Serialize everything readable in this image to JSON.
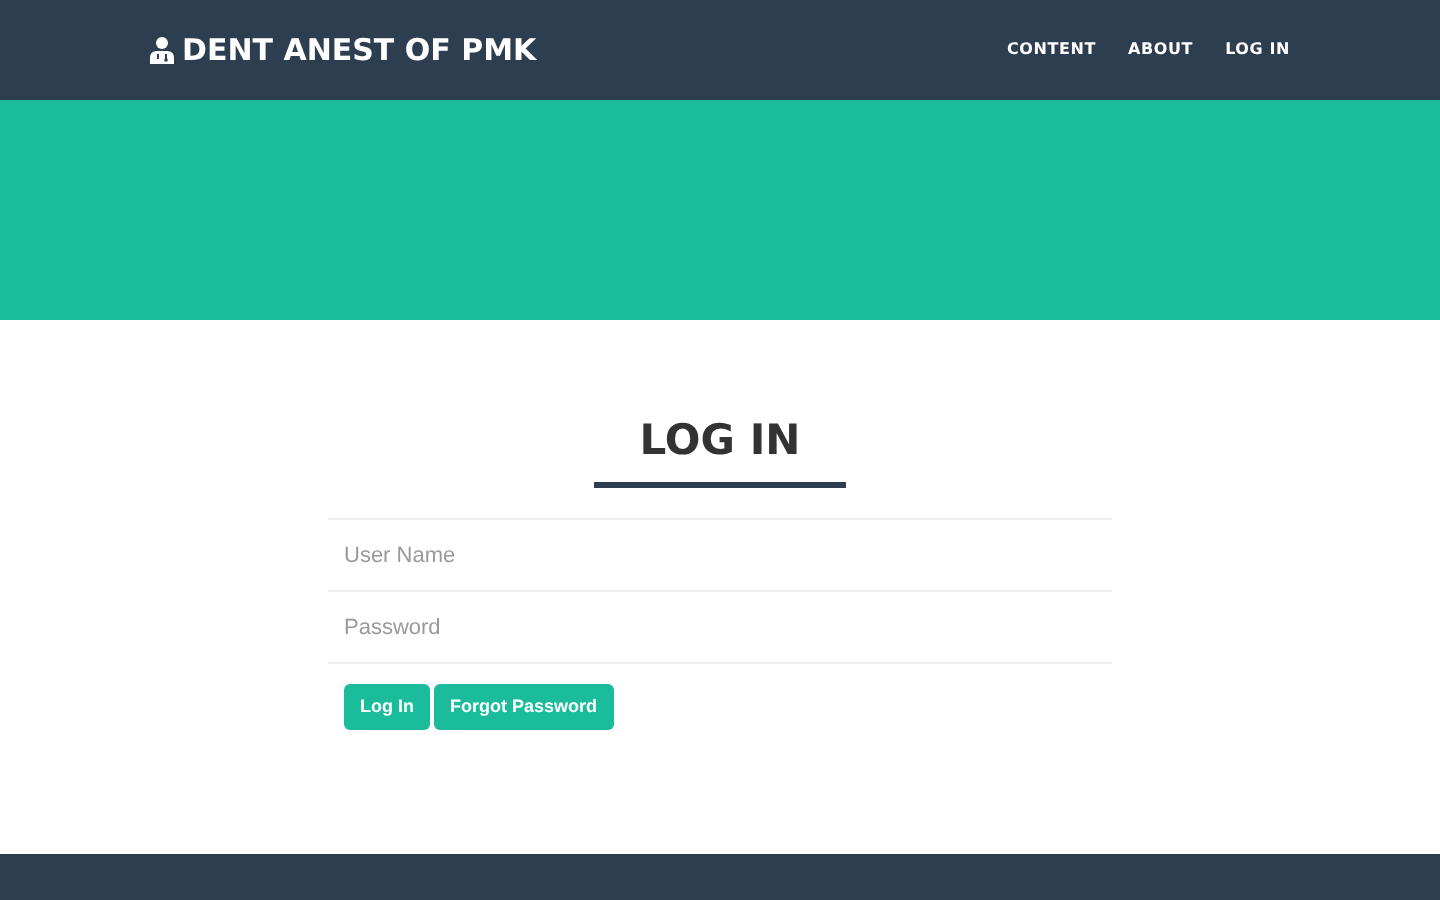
{
  "navbar": {
    "brand": "DENT ANEST OF PMK",
    "links": [
      {
        "label": "CONTENT"
      },
      {
        "label": "ABOUT"
      },
      {
        "label": "LOG IN"
      }
    ]
  },
  "login": {
    "title": "LOG IN",
    "fields": [
      {
        "placeholder": "User Name"
      },
      {
        "placeholder": "Password"
      }
    ],
    "buttons": [
      {
        "label": "Log In"
      },
      {
        "label": "Forgot Password"
      }
    ]
  }
}
